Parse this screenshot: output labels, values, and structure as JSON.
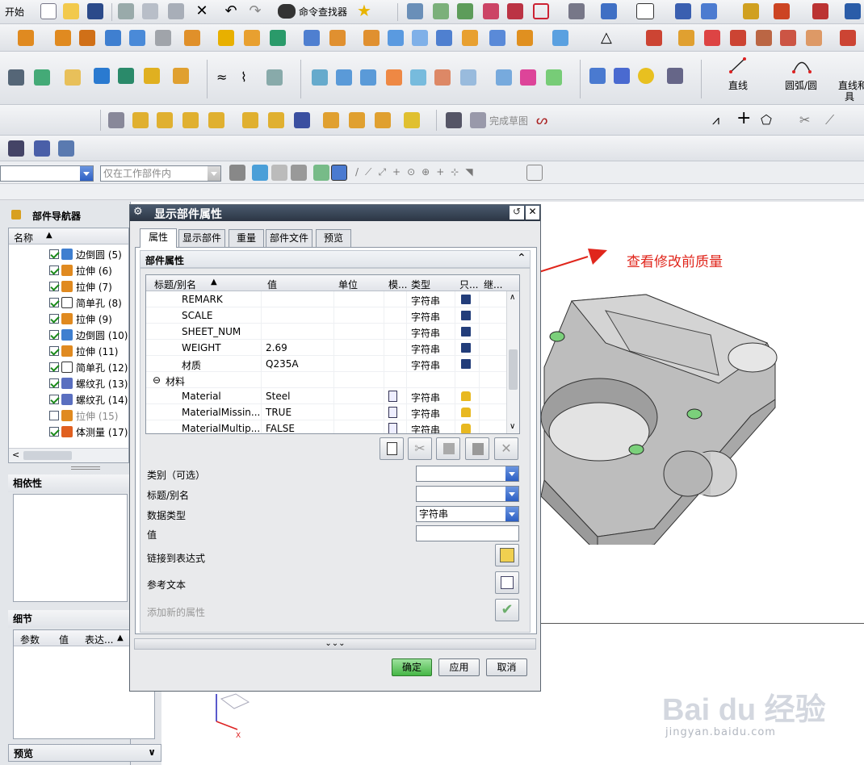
{
  "toolbar": {
    "start_label": "开始",
    "cmd_finder_label": "命令查找器",
    "finish_sketch_label": "完成草图",
    "line_label": "直线",
    "arc_label": "圆弧/圆",
    "line_arc_label": "直线和",
    "line_arc_label2": "具",
    "filter_placeholder": "仅在工作部件内"
  },
  "navigator": {
    "title": "部件导航器",
    "col_name": "名称",
    "items": [
      {
        "label": "边倒圆 (5)",
        "checked": true
      },
      {
        "label": "拉伸 (6)",
        "checked": true
      },
      {
        "label": "拉伸 (7)",
        "checked": true
      },
      {
        "label": "简单孔 (8)",
        "checked": true
      },
      {
        "label": "拉伸 (9)",
        "checked": true
      },
      {
        "label": "边倒圆 (10)",
        "checked": true
      },
      {
        "label": "拉伸 (11)",
        "checked": true
      },
      {
        "label": "简单孔 (12)",
        "checked": true
      },
      {
        "label": "螺纹孔 (13)",
        "checked": true
      },
      {
        "label": "螺纹孔 (14)",
        "checked": true
      },
      {
        "label": "拉伸 (15)",
        "checked": false
      },
      {
        "label": "体测量 (17)",
        "checked": true
      }
    ],
    "dependencies_title": "相依性",
    "details_title": "细节",
    "details_cols": [
      "参数",
      "值",
      "表达..."
    ],
    "preview_title": "预览"
  },
  "dialog": {
    "title": "显示部件属性",
    "tabs": [
      "属性",
      "显示部件",
      "重量",
      "部件文件",
      "预览"
    ],
    "section_title": "部件属性",
    "grid_cols": [
      "标题/别名",
      "值",
      "单位",
      "模...",
      "类型",
      "只...",
      "继..."
    ],
    "rows": [
      {
        "name": "REMARK",
        "value": "",
        "type": "字符串"
      },
      {
        "name": "SCALE",
        "value": "",
        "type": "字符串"
      },
      {
        "name": "SHEET_NUM",
        "value": "",
        "type": "字符串"
      },
      {
        "name": "WEIGHT",
        "value": "2.69",
        "type": "字符串"
      },
      {
        "name": "材质",
        "value": "Q235A",
        "type": "字符串"
      },
      {
        "name": "材料",
        "value": "",
        "type": ""
      },
      {
        "name": "Material",
        "value": "Steel",
        "type": "字符串"
      },
      {
        "name": "MaterialMissin...",
        "value": "TRUE",
        "type": "字符串"
      },
      {
        "name": "MaterialMultip...",
        "value": "FALSE",
        "type": "字符串"
      }
    ],
    "category_label": "类别（可选）",
    "alias_label": "标题/别名",
    "datatype_label": "数据类型",
    "datatype_value": "字符串",
    "value_label": "值",
    "link_label": "链接到表达式",
    "ref_label": "参考文本",
    "add_label": "添加新的属性",
    "ok_label": "确定",
    "apply_label": "应用",
    "cancel_label": "取消"
  },
  "annotation": {
    "text": "查看修改前质量",
    "color": "#e0261c"
  },
  "watermark": {
    "brand": "Bai du 经验",
    "url": "jingyan.baidu.com"
  }
}
